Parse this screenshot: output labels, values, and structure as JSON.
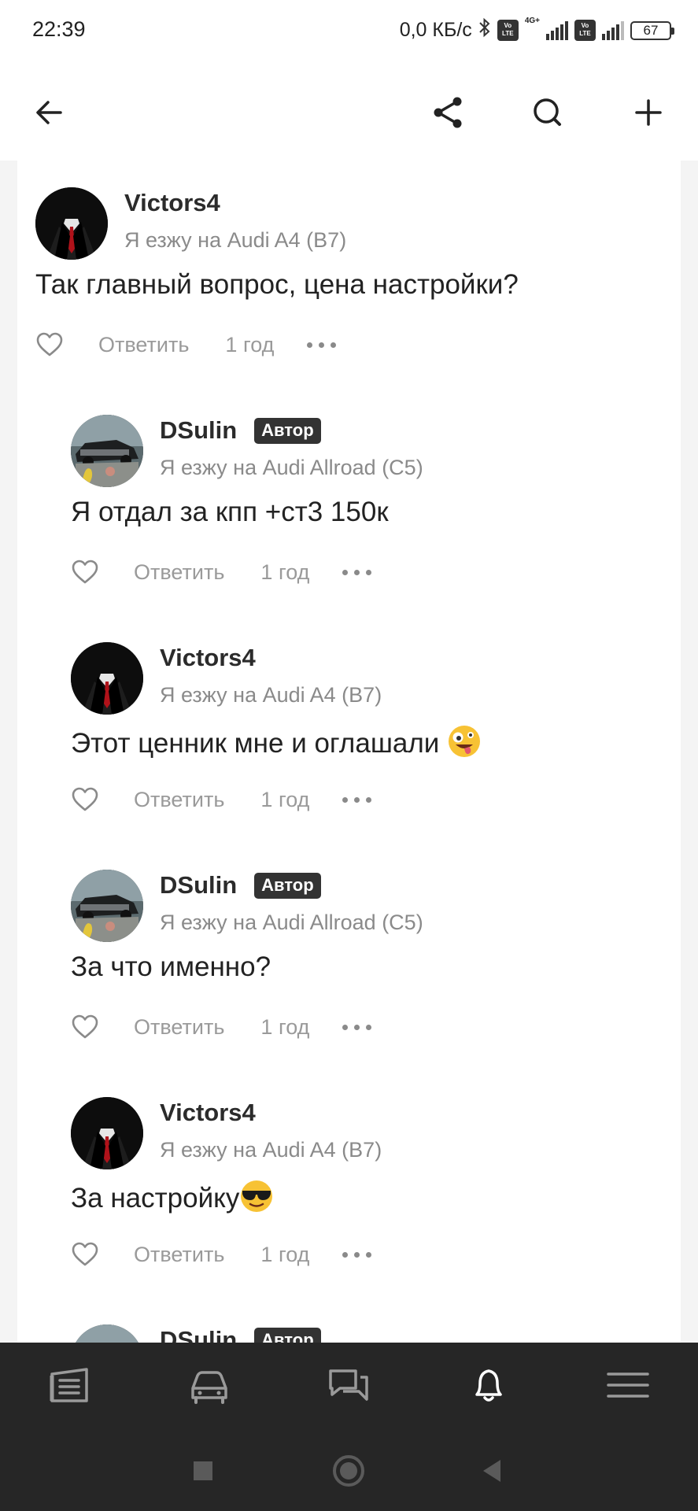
{
  "status_bar": {
    "time": "22:39",
    "speed": "0,0 КБ/с",
    "network": "4G+",
    "volte": "Vo\nLTE",
    "battery": "67"
  },
  "top_bar": {
    "back_icon": "arrow-left-icon",
    "share_icon": "share-icon",
    "search_icon": "search-icon",
    "add_icon": "plus-icon"
  },
  "comments": [
    {
      "author": "Victors4",
      "badge": "",
      "car": "Я езжу на Audi A4 (B7)",
      "text": "Так главный вопрос, цена настройки?",
      "emoji": "",
      "reply": "Ответить",
      "time": "1 год",
      "avatar": "suit-avatar"
    },
    {
      "author": "DSulin",
      "badge": "Автор",
      "car": "Я езжу на Audi Allroad (C5)",
      "text": "Я отдал за кпп +ст3 150к",
      "emoji": "",
      "reply": "Ответить",
      "time": "1 год",
      "avatar": "car-avatar"
    },
    {
      "author": "Victors4",
      "badge": "",
      "car": "Я езжу на Audi A4 (B7)",
      "text": "Этот ценник мне и оглашали",
      "emoji": "zany-face",
      "reply": "Ответить",
      "time": "1 год",
      "avatar": "suit-avatar"
    },
    {
      "author": "DSulin",
      "badge": "Автор",
      "car": "Я езжу на Audi Allroad (C5)",
      "text": "За что именно?",
      "emoji": "",
      "reply": "Ответить",
      "time": "1 год",
      "avatar": "car-avatar"
    },
    {
      "author": "Victors4",
      "badge": "",
      "car": "Я езжу на Audi A4 (B7)",
      "text": "За настройку",
      "emoji": "sunglasses-face",
      "reply": "Ответить",
      "time": "1 год",
      "avatar": "suit-avatar"
    },
    {
      "author": "DSulin",
      "badge": "Автор",
      "car": "",
      "text": "",
      "emoji": "",
      "reply": "",
      "time": "",
      "avatar": "car-avatar"
    }
  ],
  "bottom_nav": [
    {
      "icon": "journal-icon",
      "active": false
    },
    {
      "icon": "car-icon",
      "active": false
    },
    {
      "icon": "chat-icon",
      "active": false
    },
    {
      "icon": "bell-icon",
      "active": true
    },
    {
      "icon": "menu-icon",
      "active": false
    }
  ],
  "colors": {
    "text": "#222222",
    "muted": "#8a8a8a",
    "badge_bg": "#333333",
    "nav_bg": "#262626",
    "nav_icon": "#9a9a9a",
    "nav_active": "#ffffff"
  }
}
